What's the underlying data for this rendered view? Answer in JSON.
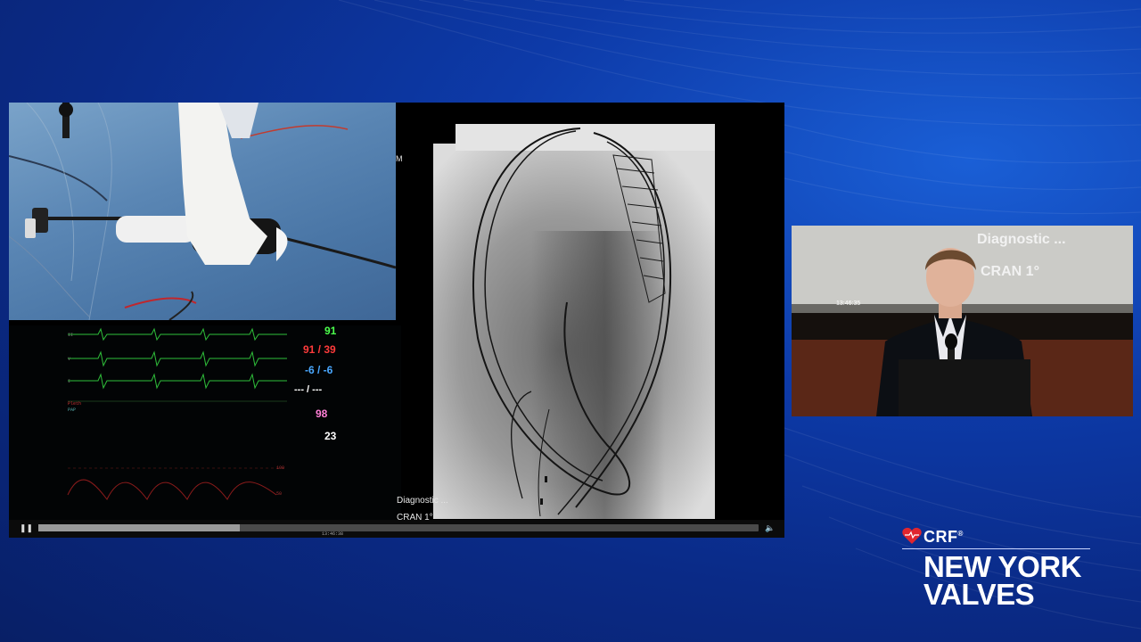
{
  "feed": {
    "monitor": {
      "vitals": [
        {
          "id": "hr",
          "value": "91",
          "color": "#4cff4c"
        },
        {
          "id": "bp",
          "value": "91 / 39",
          "color": "#ff3b3b"
        },
        {
          "id": "pressure2",
          "value": "-6 / -6",
          "color": "#4aa8ff"
        },
        {
          "id": "pressure3",
          "value": "--- / ---",
          "color": "#ffffff"
        },
        {
          "id": "spo2",
          "value": "98",
          "color": "#ff7fd6"
        },
        {
          "id": "resp",
          "value": "23",
          "color": "#ffffff"
        }
      ]
    },
    "overlay": {
      "line1": "Diagnostic ...",
      "line2": "CRAN 1°"
    },
    "player": {
      "progress_percent": 28,
      "time_readout": "13:46:38",
      "pause_icon": "pause-icon",
      "volume_icon": "volume-icon"
    }
  },
  "presenter": {
    "overlay_line1": "Diagnostic ...",
    "overlay_line2": "CRAN 1°",
    "timestamp": "13:46:35"
  },
  "logo": {
    "org": "CRF",
    "mark": "®",
    "title_line1": "NEW YORK",
    "title_line2": "VALVES",
    "heart_color": "#e0262f"
  }
}
